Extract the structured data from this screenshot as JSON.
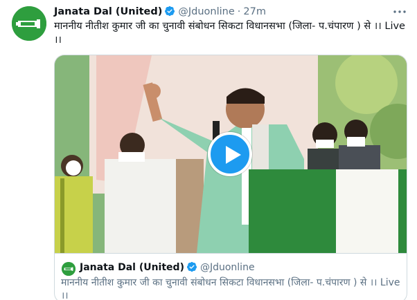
{
  "tweet": {
    "author_name": "Janata Dal (United)",
    "handle": "@Jduonline",
    "separator": "·",
    "time": "27m",
    "text": "माननीय नीतीश कुमार जी का चुनावी संबोधन सिकटा विधानसभा (जिला- प.चंपारण ) से ।। Live ।।",
    "verified": true
  },
  "media": {
    "type": "video",
    "play_icon": "play-icon"
  },
  "quoted": {
    "author_name": "Janata Dal (United)",
    "handle": "@Jduonline",
    "text": "माननीय नीतीश कुमार जी का चुनावी संबोधन सिकटा विधानसभा (जिला- प.चंपारण ) से ।। Live ।।"
  },
  "colors": {
    "accent": "#1d9bf0",
    "party_green": "#2e9e3e",
    "secondary_text": "#5b7083"
  }
}
